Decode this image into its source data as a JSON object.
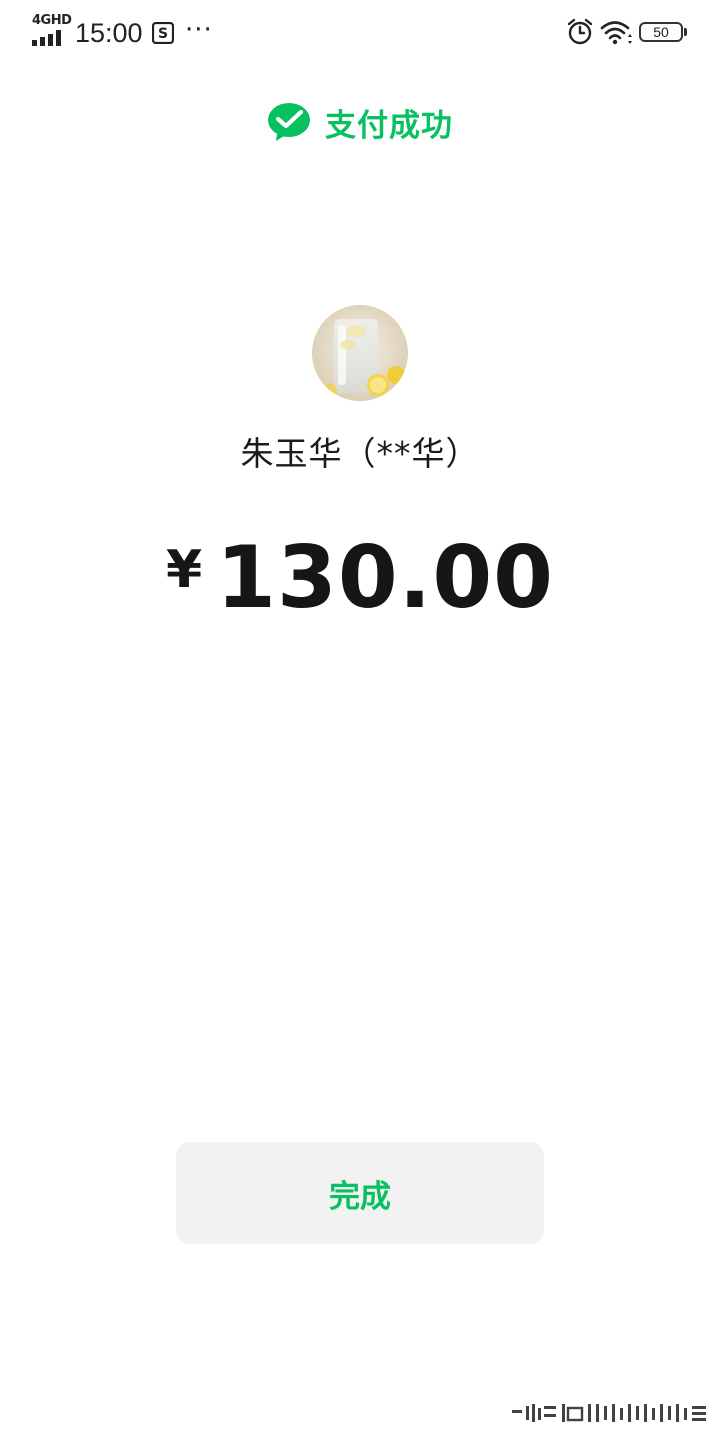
{
  "status_bar": {
    "network": "4GHD",
    "time": "15:00",
    "more": "···",
    "battery": "50",
    "icons": [
      "signal-icon",
      "screenshot-app-icon",
      "alarm-icon",
      "wifi-icon",
      "battery-icon"
    ]
  },
  "header": {
    "logo_icon": "wechat-pay-check-icon",
    "title": "支付成功"
  },
  "payee": {
    "avatar": "lemon-water-avatar",
    "name": "朱玉华（**华）"
  },
  "payment": {
    "currency": "¥",
    "amount": "130.00"
  },
  "actions": {
    "done_label": "完成"
  },
  "colors": {
    "accent": "#07C160",
    "text": "#1b1b1b",
    "button_bg": "#f2f2f2",
    "background": "#ffffff"
  }
}
